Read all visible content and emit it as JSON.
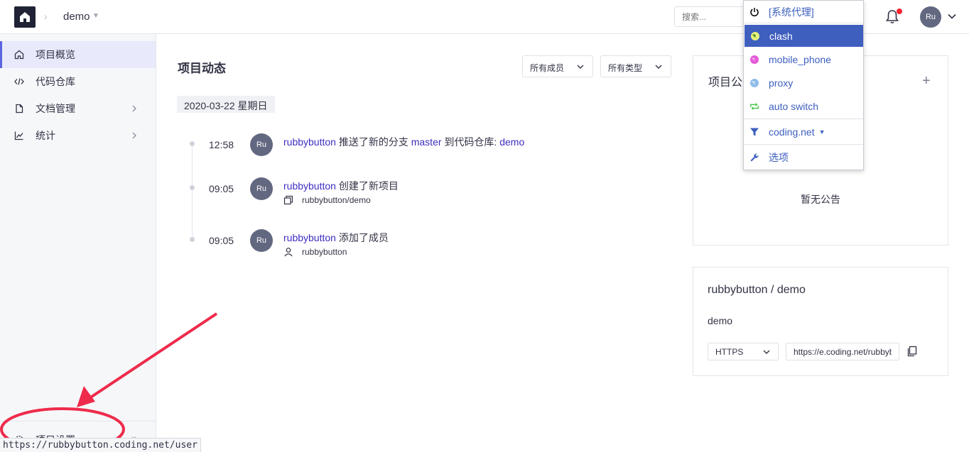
{
  "topbar": {
    "project_name": "demo",
    "search_placeholder": "搜索...",
    "avatar_initials": "Ru"
  },
  "sidebar": {
    "items": [
      {
        "label": "项目概览",
        "icon": "home-icon",
        "active": true
      },
      {
        "label": "代码仓库",
        "icon": "code-icon",
        "active": false
      },
      {
        "label": "文档管理",
        "icon": "file-icon",
        "active": false
      },
      {
        "label": "统计",
        "icon": "chart-icon",
        "active": false
      }
    ],
    "settings_label": "项目设置"
  },
  "feed": {
    "title": "项目动态",
    "filter_members": "所有成员",
    "filter_types": "所有类型",
    "date": "2020-03-22 星期日",
    "events": [
      {
        "time": "12:58",
        "avatar": "Ru",
        "user": "rubbybutton",
        "action": "推送了新的分支",
        "branch": "master",
        "action2": "到代码仓库:",
        "repo": "demo"
      },
      {
        "time": "09:05",
        "avatar": "Ru",
        "user": "rubbybutton",
        "action": "创建了新项目",
        "sub": "rubbybutton/demo"
      },
      {
        "time": "09:05",
        "avatar": "Ru",
        "user": "rubbybutton",
        "action": "添加了成员",
        "sub": "rubbybutton"
      }
    ]
  },
  "announcement": {
    "title": "项目公告",
    "empty_text": "暂无公告"
  },
  "repo_card": {
    "title": "rubbybutton / demo",
    "description": "demo",
    "protocol": "HTTPS",
    "url": "https://e.coding.net/rubbybutton/demo.git"
  },
  "proxy_popup": {
    "items": [
      {
        "label": "[系统代理]",
        "icon": "power-icon"
      },
      {
        "label": "clash",
        "icon": "globe-icon",
        "selected": true
      },
      {
        "label": "mobile_phone",
        "icon": "globe-icon"
      },
      {
        "label": "proxy",
        "icon": "globe-icon"
      },
      {
        "label": "auto switch",
        "icon": "switch-icon"
      },
      {
        "label": "coding.net",
        "icon": "filter-icon"
      },
      {
        "label": "选项",
        "icon": "wrench-icon"
      }
    ]
  },
  "status_bar": {
    "url": "https://rubbybutton.coding.net/user"
  },
  "colors": {
    "accent": "#5b63df",
    "link": "#3d2ec0",
    "annotation": "#ee2b4b",
    "popup_selected": "#3f5fbf"
  }
}
